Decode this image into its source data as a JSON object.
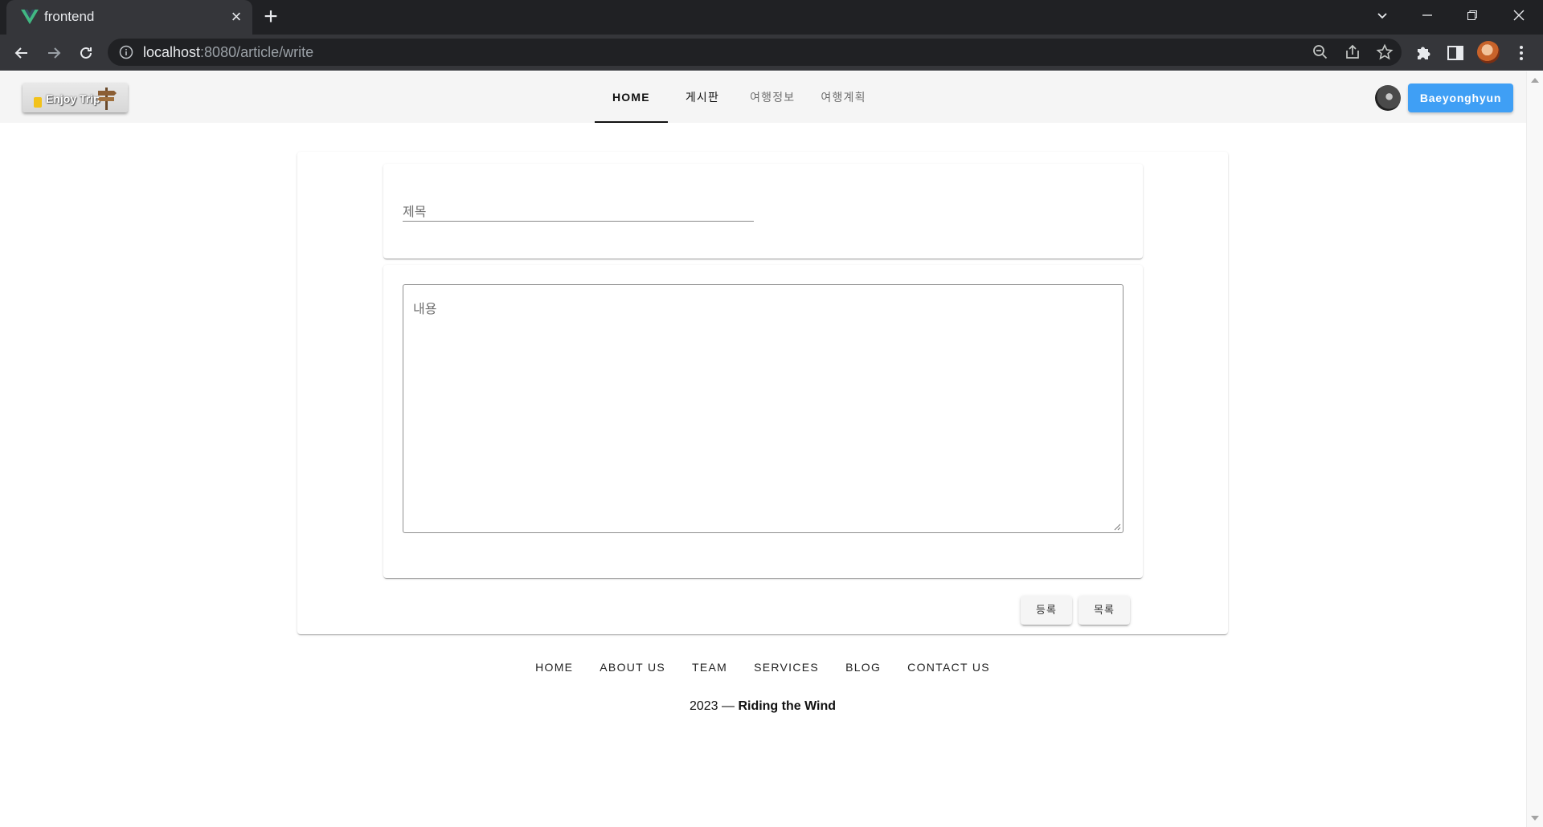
{
  "browser": {
    "tab_title": "frontend",
    "url_host": "localhost",
    "url_rest": ":8080/article/write"
  },
  "header": {
    "logo_text": "Enjoy Trip",
    "nav": [
      "HOME",
      "게시판",
      "여행정보",
      "여행계획"
    ],
    "active_nav": "HOME",
    "user_button": "Baeyonghyun"
  },
  "form": {
    "title_placeholder": "제목",
    "content_placeholder": "내용",
    "register_label": "등록",
    "list_label": "목록"
  },
  "footer": {
    "links": [
      "HOME",
      "ABOUT US",
      "TEAM",
      "SERVICES",
      "BLOG",
      "CONTACT US"
    ],
    "year": "2023 —",
    "owner": "Riding the Wind"
  },
  "colors": {
    "user_button": "#3f9ff5",
    "chrome_dark": "#202124",
    "vue_green": "#41b883"
  }
}
